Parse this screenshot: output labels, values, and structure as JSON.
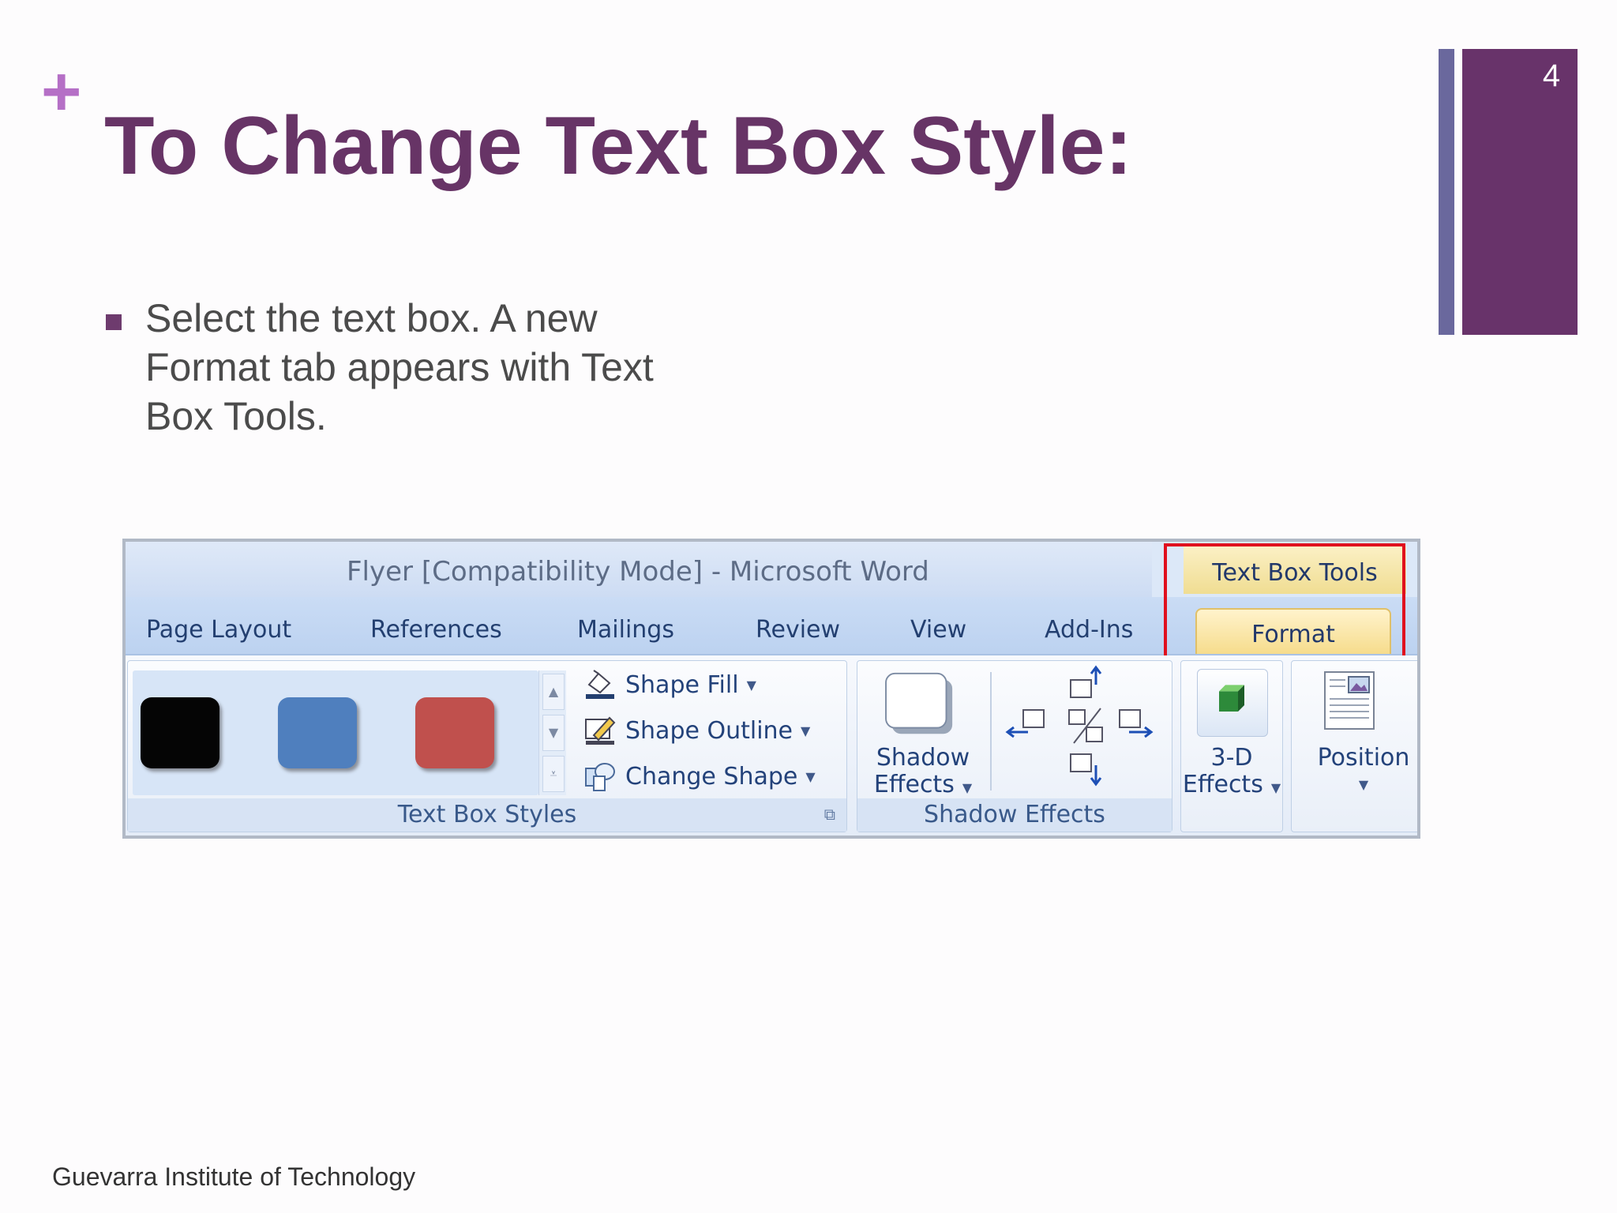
{
  "slide": {
    "plus": "+",
    "title": "To Change Text Box Style:",
    "page_number": "4",
    "bullet": "Select the text box. A new Format tab appears with Text Box Tools.",
    "footer": "Guevarra Institute of Technology"
  },
  "ribbon": {
    "window_title": "Flyer [Compatibility Mode]  -  Microsoft Word",
    "tabs": [
      "Page Layout",
      "References",
      "Mailings",
      "Review",
      "View",
      "Add-Ins"
    ],
    "contextual_header": "Text Box Tools",
    "active_tab": "Format",
    "highlight_color": "#e0101e",
    "text_box_styles": {
      "label": "Text Box Styles",
      "swatch_colors": [
        "#050505",
        "#4f7fbe",
        "#c0504d"
      ],
      "commands": [
        "Shape Fill",
        "Shape Outline",
        "Change Shape"
      ]
    },
    "shadow_effects": {
      "button_line1": "Shadow",
      "button_line2": "Effects",
      "label": "Shadow Effects"
    },
    "three_d": {
      "line1": "3-D",
      "line2": "Effects"
    },
    "position": {
      "label": "Position"
    }
  }
}
